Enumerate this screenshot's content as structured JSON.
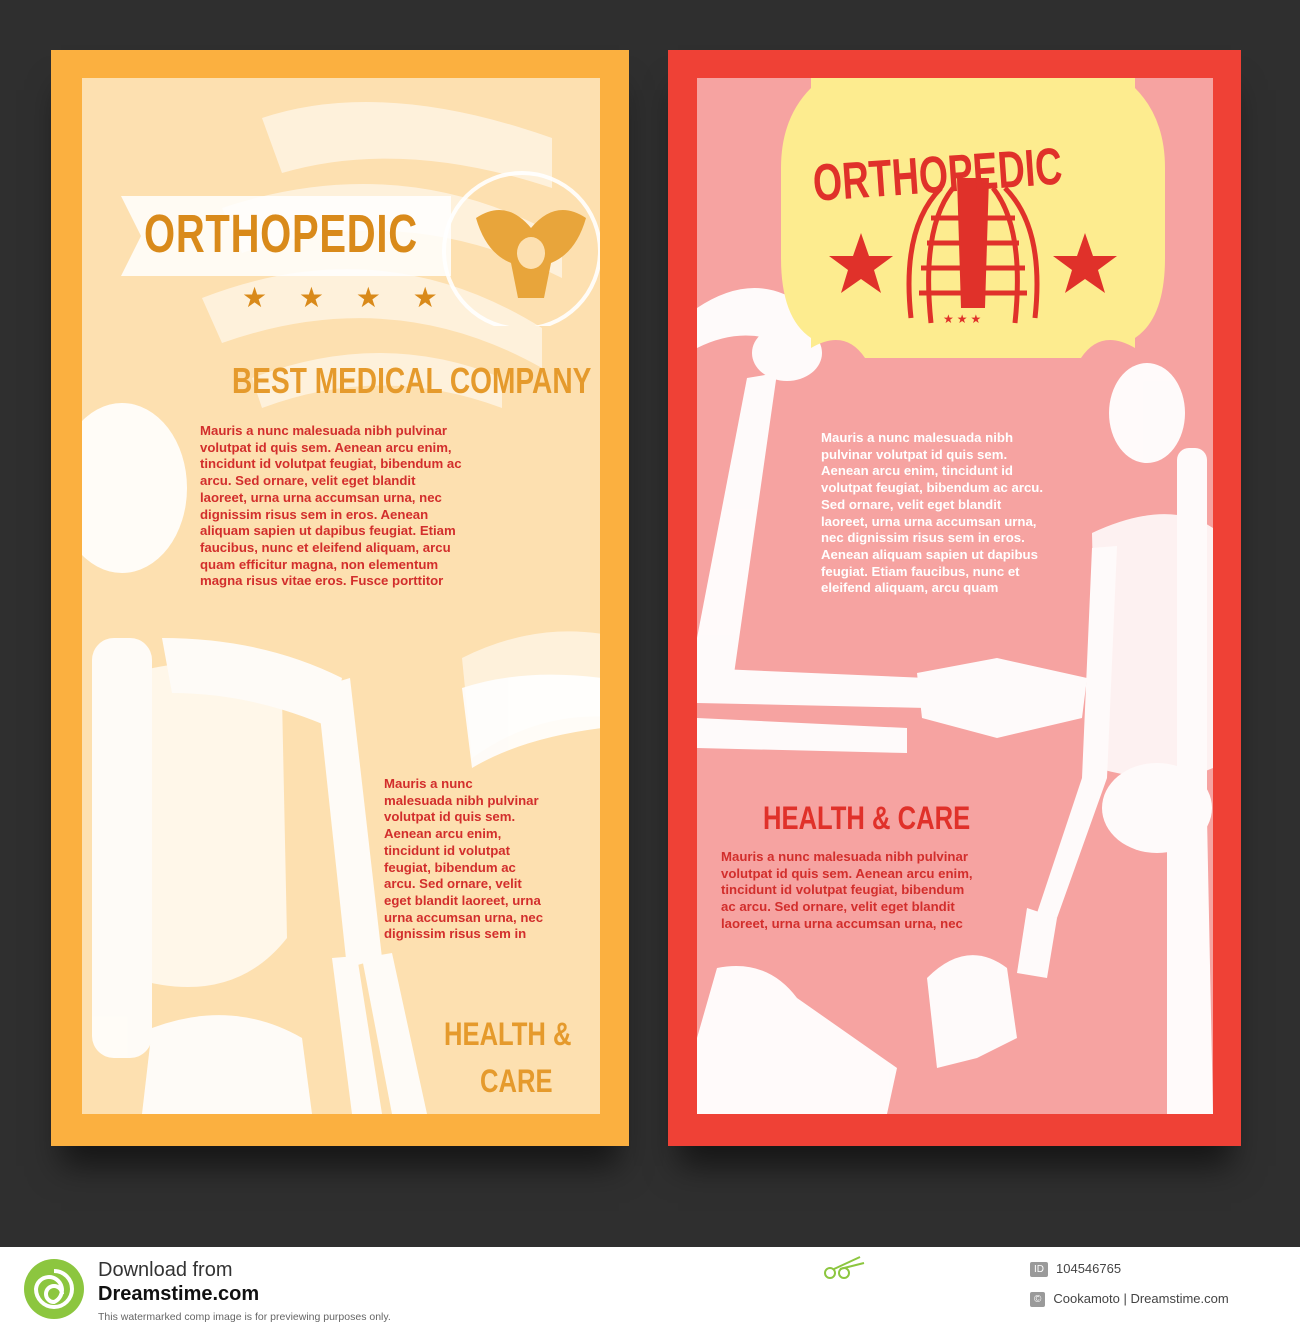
{
  "left_flyer": {
    "title": "ORTHOPEDIC",
    "stars": "★ ★ ★ ★",
    "subtitle": "BEST MEDICAL COMPANY",
    "paragraph1_lines": [
      "Mauris a nunc malesuada nibh pulvinar",
      "volutpat id quis sem. Aenean arcu enim,",
      "tincidunt id volutpat feugiat, bibendum ac",
      "arcu. Sed ornare, velit eget blandit",
      "laoreet, urna urna accumsan urna, nec",
      "dignissim risus sem in eros. Aenean",
      "aliquam sapien ut dapibus feugiat. Etiam",
      "faucibus, nunc et eleifend aliquam, arcu",
      "quam efficitur magna, non elementum",
      "magna risus vitae eros. Fusce porttitor"
    ],
    "paragraph2_lines": [
      "Mauris a nunc",
      "malesuada nibh pulvinar",
      "volutpat id quis sem.",
      "Aenean arcu enim,",
      "tincidunt id volutpat",
      "feugiat, bibendum ac",
      "arcu. Sed ornare, velit",
      "eget blandit laoreet, urna",
      "urna accumsan urna, nec",
      "dignissim risus sem in"
    ],
    "footer_heading_line1": "HEALTH &",
    "footer_heading_line2": "CARE"
  },
  "right_flyer": {
    "title": "ORTHOPEDIC",
    "small_stars": "★★★",
    "paragraph1_lines": [
      "Mauris a nunc malesuada nibh",
      "pulvinar volutpat id quis sem.",
      "Aenean arcu enim, tincidunt id",
      "volutpat feugiat, bibendum ac arcu.",
      "Sed ornare, velit eget blandit",
      "laoreet, urna urna accumsan urna,",
      "nec dignissim risus sem in eros.",
      "Aenean aliquam sapien ut dapibus",
      "feugiat. Etiam faucibus, nunc et",
      "eleifend aliquam, arcu quam"
    ],
    "heading": "HEALTH & CARE",
    "paragraph2_lines": [
      "Mauris a nunc malesuada nibh pulvinar",
      "volutpat id quis sem. Aenean arcu enim,",
      "tincidunt id volutpat feugiat, bibendum",
      "ac arcu. Sed ornare, velit eget blandit",
      "laoreet, urna urna accumsan urna, nec"
    ]
  },
  "footer": {
    "download_line": "Download from",
    "site": "Dreamstime.com",
    "note": "This watermarked comp image is for previewing purposes only.",
    "id_tag": "ID",
    "id_value": "104546765",
    "author_tag": "©",
    "author": "Cookamoto | Dreamstime.com"
  },
  "colors": {
    "left_frame": "#fbb040",
    "left_panel": "#fde0b0",
    "left_accent": "#d98a1a",
    "left_text": "#d22e2c",
    "right_frame": "#ef4136",
    "right_panel": "#f6a3a1",
    "right_badge": "#fdec8f",
    "right_accent": "#e0312a"
  }
}
